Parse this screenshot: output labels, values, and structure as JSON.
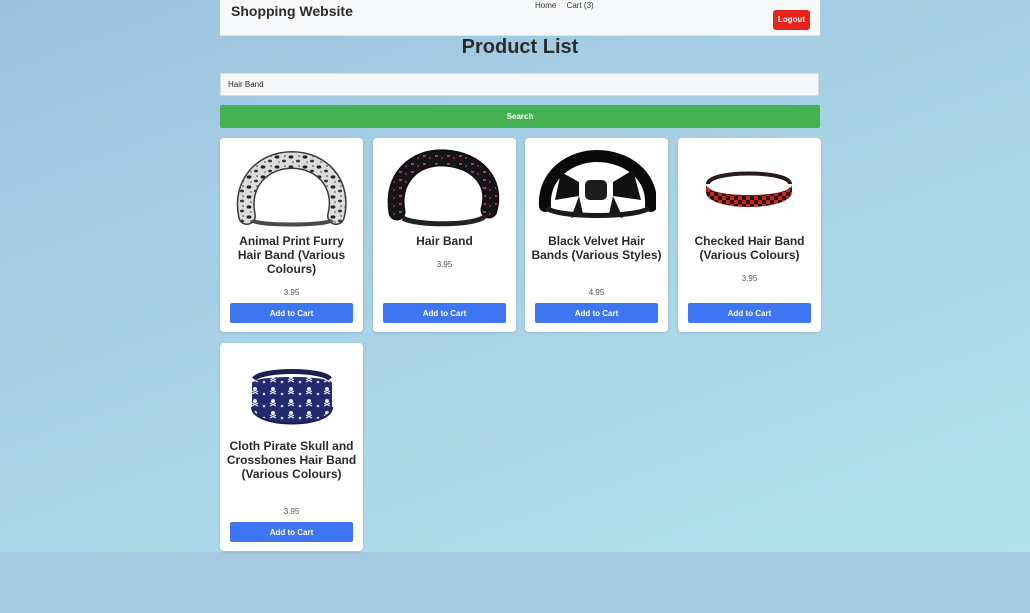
{
  "header": {
    "brand": "Shopping Website",
    "nav": {
      "home": "Home",
      "cart": "Cart (3)"
    },
    "logout_label": "Logout"
  },
  "page": {
    "title": "Product List"
  },
  "search": {
    "value": "Hair Band",
    "button_label": "Search"
  },
  "products": [
    {
      "name": "Animal Print Furry Hair Band (Various Colours)",
      "price": "3.95",
      "add_label": "Add to Cart",
      "image_icon": "leopard-headband-icon"
    },
    {
      "name": "Hair Band",
      "price": "3.95",
      "add_label": "Add to Cart",
      "image_icon": "black-pink-headband-icon"
    },
    {
      "name": "Black Velvet Hair Bands (Various Styles)",
      "price": "4.95",
      "add_label": "Add to Cart",
      "image_icon": "velvet-bow-headband-icon"
    },
    {
      "name": "Checked Hair Band (Various Colours)",
      "price": "3.95",
      "add_label": "Add to Cart",
      "image_icon": "checked-headband-icon"
    },
    {
      "name": "Cloth Pirate Skull and Crossbones Hair Band (Various Colours)",
      "price": "3.95",
      "add_label": "Add to Cart",
      "image_icon": "pirate-skull-headband-icon"
    }
  ],
  "colors": {
    "logout": "#e8231b",
    "search_button": "#45b152",
    "add_button": "#3d75f2"
  }
}
